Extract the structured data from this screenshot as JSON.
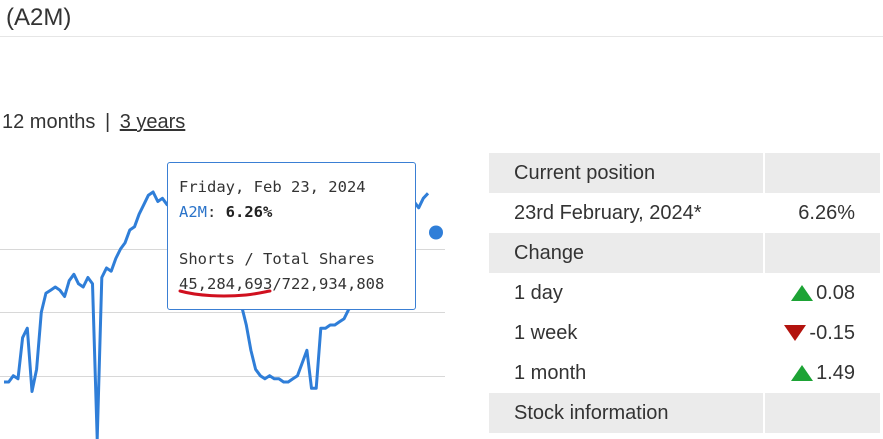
{
  "page": {
    "ticker": "(A2M)"
  },
  "periods": {
    "current": "12 months",
    "separator": "|",
    "other": "3 years"
  },
  "tooltip": {
    "date": "Friday, Feb 23, 2024",
    "series": "A2M",
    "value": "6.26%",
    "label": "Shorts / Total Shares",
    "shorts": "45,284,693",
    "slash": "/",
    "total": "722,934,808"
  },
  "colors": {
    "line": "#2f7ed8",
    "tooltip_border": "#3a7fd4",
    "up": "#1da335",
    "down": "#b3130e",
    "annotation": "#d0101f"
  },
  "panel": {
    "current_heading": "Current position",
    "current_date": "23rd February, 2024*",
    "current_value": "6.26%",
    "change_heading": "Change",
    "changes": [
      {
        "period": "1 day",
        "direction": "up",
        "value": "0.08"
      },
      {
        "period": "1 week",
        "direction": "down",
        "value": "-0.15"
      },
      {
        "period": "1 month",
        "direction": "up",
        "value": "1.49"
      }
    ],
    "stock_heading": "Stock information"
  },
  "chart_data": {
    "type": "line",
    "series": [
      {
        "name": "A2M",
        "values": [
          3.9,
          3.9,
          4.0,
          3.95,
          4.6,
          4.75,
          3.75,
          4.1,
          5.0,
          5.3,
          5.35,
          5.4,
          5.35,
          5.25,
          5.5,
          5.6,
          5.45,
          5.4,
          5.55,
          5.45,
          3.0,
          5.55,
          5.7,
          5.65,
          5.85,
          6.0,
          6.1,
          6.3,
          6.35,
          6.55,
          6.7,
          6.85,
          6.9,
          6.75,
          6.8,
          6.7,
          6.75,
          6.7,
          6.8,
          6.7,
          6.8,
          6.7,
          6.85,
          6.75,
          6.65,
          6.4,
          6.3,
          6.15,
          5.8,
          5.5,
          5.3,
          5.1,
          4.8,
          4.4,
          4.1,
          4.0,
          3.95,
          4.0,
          3.95,
          3.95,
          3.9,
          3.9,
          3.95,
          4.0,
          4.2,
          4.4,
          3.8,
          3.8,
          4.75,
          4.75,
          4.8,
          4.8,
          4.85,
          4.9,
          5.05,
          5.1,
          5.2,
          5.2,
          5.15,
          5.3,
          5.4,
          5.45,
          5.6,
          5.65,
          5.7,
          5.8,
          6.1,
          7.15,
          6.75,
          6.65,
          6.8,
          6.88
        ],
        "last_point": 6.26
      }
    ],
    "gridlines": [
      4.0,
      5.0,
      6.0
    ],
    "ylim": [
      3.0,
      7.5
    ]
  }
}
